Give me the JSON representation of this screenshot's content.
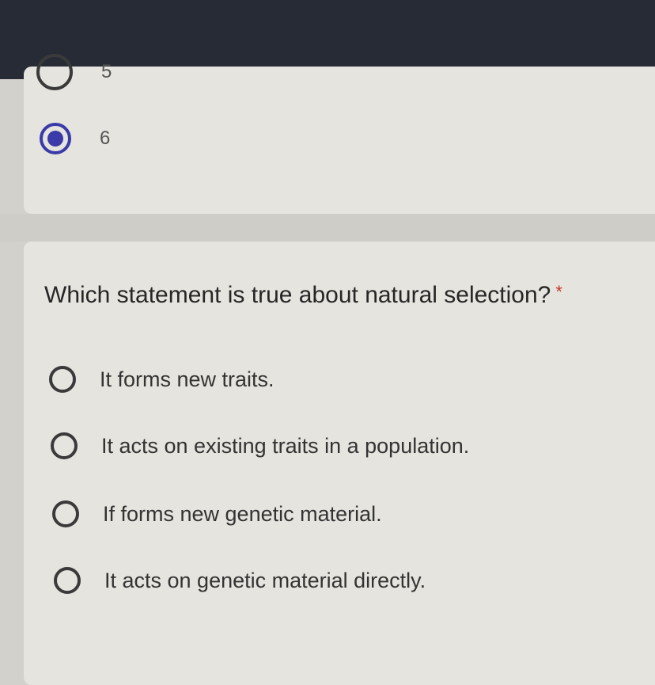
{
  "previous_question": {
    "options": [
      {
        "label": "5",
        "selected": false
      },
      {
        "label": "6",
        "selected": true
      }
    ]
  },
  "question": {
    "text": "Which statement is true about natural selection?",
    "required_marker": "*",
    "options": [
      {
        "label": "It forms new traits.",
        "selected": false
      },
      {
        "label": "It acts on existing traits in a population.",
        "selected": false
      },
      {
        "label": "If forms new genetic material.",
        "selected": false
      },
      {
        "label": "It acts on genetic material directly.",
        "selected": false
      }
    ]
  },
  "colors": {
    "header": "#262b35",
    "card": "#e6e4df",
    "radio_checked": "#3a3aa8"
  }
}
